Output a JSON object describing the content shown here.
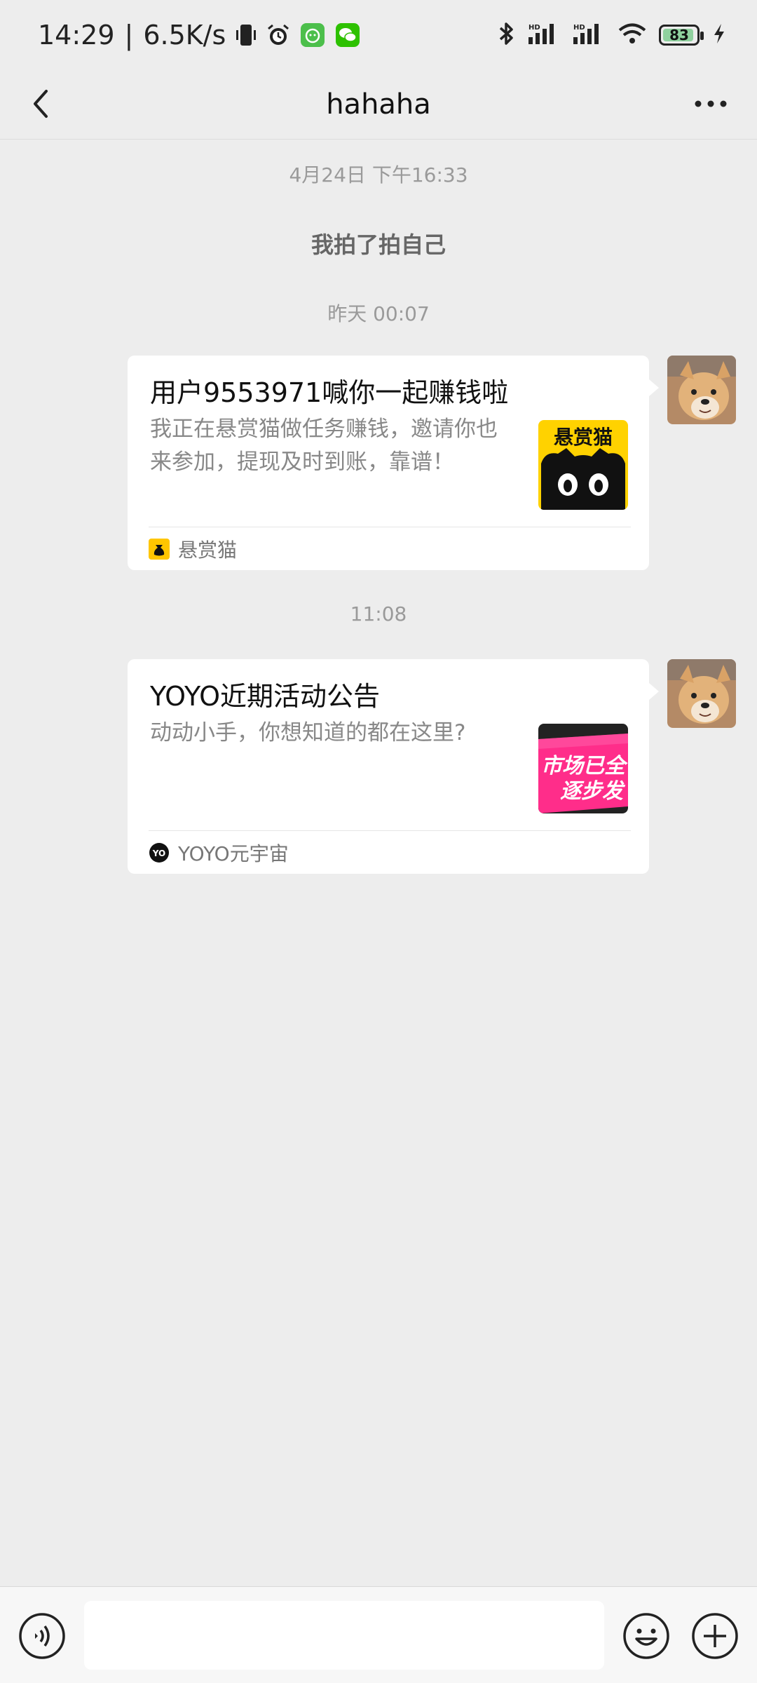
{
  "status_bar": {
    "time": "14:29",
    "separator": "|",
    "net_speed": "6.5K/s",
    "battery_level": "83",
    "icons": [
      "vibrate-icon",
      "alarm-icon",
      "app-icon",
      "wechat-icon",
      "bluetooth-icon",
      "signal-icon",
      "signal-icon",
      "wifi-icon",
      "battery-icon",
      "charging-icon"
    ]
  },
  "header": {
    "title": "hahaha"
  },
  "chat": {
    "timestamps": [
      "4月24日 下午16:33",
      "昨天 00:07",
      "11:08"
    ],
    "system_message": "我拍了拍自己",
    "messages": [
      {
        "title": "用户9553971喊你一起赚钱啦",
        "description": "我正在悬赏猫做任务赚钱，邀请你也来参加，提现及时到账，靠谱！",
        "thumb_text": "悬赏猫",
        "source": "悬赏猫"
      },
      {
        "title": "YOYO近期活动公告",
        "description": "动动小手，你想知道的都在这里?",
        "thumb_text": "市场已全\n逐步发",
        "source": "YOYO元宇宙",
        "source_icon_text": "YO"
      }
    ]
  },
  "input_bar": {
    "placeholder": ""
  },
  "colors": {
    "background": "#ededed",
    "card": "#ffffff",
    "brand_yellow": "#ffd200",
    "promo_pink": "#ff2d8a"
  }
}
